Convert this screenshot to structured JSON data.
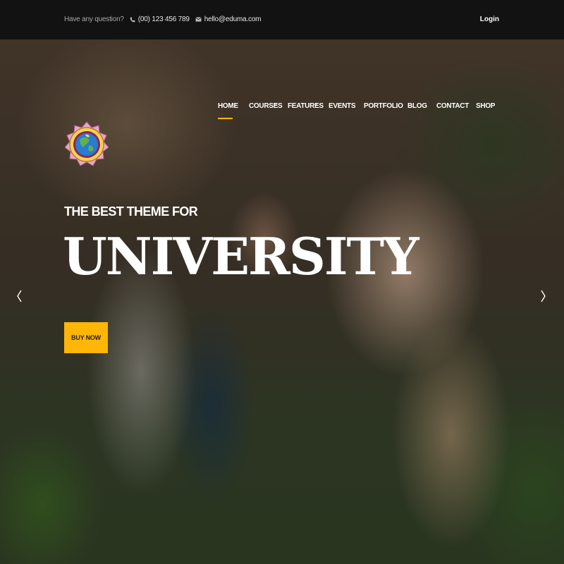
{
  "topbar": {
    "question": "Have any question?",
    "phone": "(00) 123 456 789",
    "email": "hello@eduma.com",
    "login": "Login",
    "icons": {
      "phone": "phone-icon",
      "email": "envelope-icon"
    }
  },
  "nav": {
    "items": [
      {
        "label": "HOME",
        "active": true,
        "dropdown": false
      },
      {
        "label": "COURSES",
        "active": false,
        "dropdown": true
      },
      {
        "label": "FEATURES",
        "active": false,
        "dropdown": true
      },
      {
        "label": "EVENTS",
        "active": false,
        "dropdown": false
      },
      {
        "label": "PORTFOLIO",
        "active": false,
        "dropdown": false
      },
      {
        "label": "BLOG",
        "active": false,
        "dropdown": false
      },
      {
        "label": "CONTACT",
        "active": false,
        "dropdown": false
      },
      {
        "label": "SHOP",
        "active": false,
        "dropdown": false
      }
    ]
  },
  "hero": {
    "eyebrow": "THE BEST THEME FOR",
    "headline": "UNIVERSITY",
    "cta": "BUY NOW",
    "icons": {
      "prev": "chevron-left-icon",
      "next": "chevron-right-icon"
    }
  },
  "colors": {
    "accent": "#ffb606",
    "topbar_bg": "#121212",
    "text": "#ffffff"
  }
}
